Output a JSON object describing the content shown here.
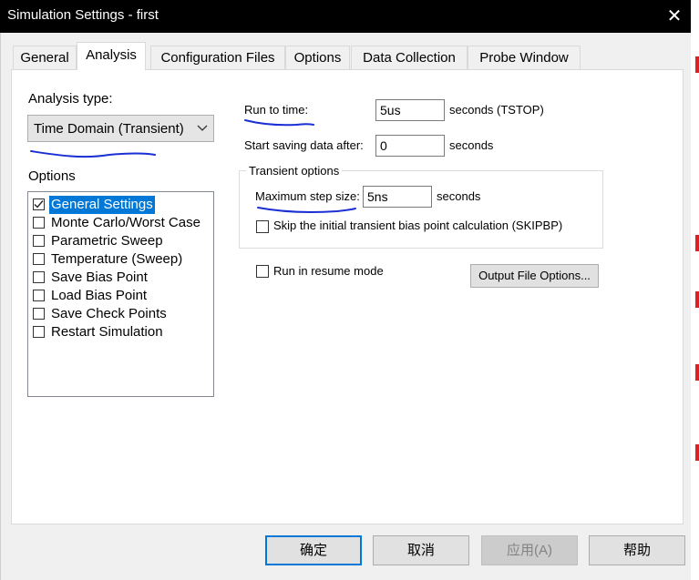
{
  "window": {
    "title": "Simulation Settings - first",
    "close_glyph": "✕"
  },
  "tabs": [
    {
      "label": "General"
    },
    {
      "label": "Analysis"
    },
    {
      "label": "Configuration Files"
    },
    {
      "label": "Options"
    },
    {
      "label": "Data Collection"
    },
    {
      "label": "Probe Window"
    }
  ],
  "analysis": {
    "type_label": "Analysis type:",
    "type_value": "Time Domain (Transient)",
    "options_label": "Options",
    "options": [
      {
        "label": "General Settings",
        "checked": true,
        "selected": true
      },
      {
        "label": "Monte Carlo/Worst Case",
        "checked": false
      },
      {
        "label": "Parametric Sweep",
        "checked": false
      },
      {
        "label": "Temperature (Sweep)",
        "checked": false
      },
      {
        "label": "Save Bias Point",
        "checked": false
      },
      {
        "label": "Load Bias Point",
        "checked": false
      },
      {
        "label": "Save Check Points",
        "checked": false
      },
      {
        "label": "Restart Simulation",
        "checked": false
      }
    ]
  },
  "settings": {
    "run_to_time_label": "Run to time:",
    "run_to_time_value": "5us",
    "run_to_time_unit": "seconds  (TSTOP)",
    "start_saving_label": "Start saving data after:",
    "start_saving_value": "0",
    "start_saving_unit": "seconds",
    "transient_group_label": "Transient options",
    "max_step_label": "Maximum step size:",
    "max_step_value": "5ns",
    "max_step_unit": "seconds",
    "skip_bias_label": "Skip the initial transient bias point calculation  (SKIPBP)",
    "skip_bias_checked": false,
    "resume_label": "Run in resume mode",
    "resume_checked": false,
    "output_file_options_label": "Output File Options..."
  },
  "buttons": {
    "ok": "确定",
    "cancel": "取消",
    "apply": "应用(A)",
    "help": "帮助"
  },
  "colors": {
    "selection": "#0078d7",
    "annotation_pen": "#1a2fd4",
    "title_bar": "#000000",
    "side_marks": "#e02020"
  }
}
